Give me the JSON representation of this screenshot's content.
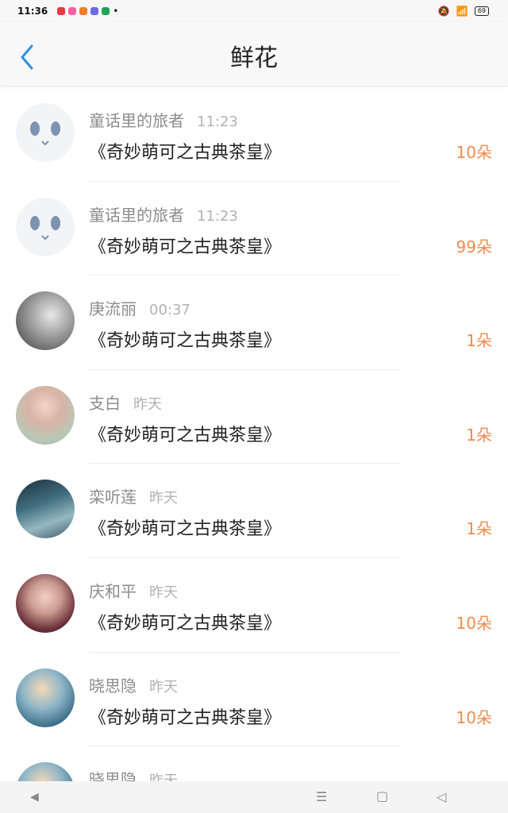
{
  "status_bar": {
    "time": "11:36",
    "battery": "69"
  },
  "header": {
    "title": "鲜花"
  },
  "items": [
    {
      "name": "童话里的旅者",
      "time": "11:23",
      "title": "《奇妙萌可之古典茶皇》",
      "count": "10朵",
      "avatar": "face-avatar"
    },
    {
      "name": "童话里的旅者",
      "time": "11:23",
      "title": "《奇妙萌可之古典茶皇》",
      "count": "99朵",
      "avatar": "face-avatar"
    },
    {
      "name": "庚流丽",
      "time": "00:37",
      "title": "《奇妙萌可之古典茶皇》",
      "count": "1朵",
      "avatar": "photo-avatar"
    },
    {
      "name": "支白",
      "time": "昨天",
      "title": "《奇妙萌可之古典茶皇》",
      "count": "1朵",
      "avatar": "photo-avatar"
    },
    {
      "name": "栾听莲",
      "time": "昨天",
      "title": "《奇妙萌可之古典茶皇》",
      "count": "1朵",
      "avatar": "photo-avatar"
    },
    {
      "name": "庆和平",
      "time": "昨天",
      "title": "《奇妙萌可之古典茶皇》",
      "count": "10朵",
      "avatar": "photo-avatar"
    },
    {
      "name": "晓思隐",
      "time": "昨天",
      "title": "《奇妙萌可之古典茶皇》",
      "count": "10朵",
      "avatar": "photo-avatar"
    },
    {
      "name": "晓思隐",
      "time": "昨天",
      "title": "",
      "count": "",
      "avatar": "photo-avatar"
    }
  ],
  "colors": {
    "accent": "#2f8fe0",
    "count": "#f08a4b"
  }
}
